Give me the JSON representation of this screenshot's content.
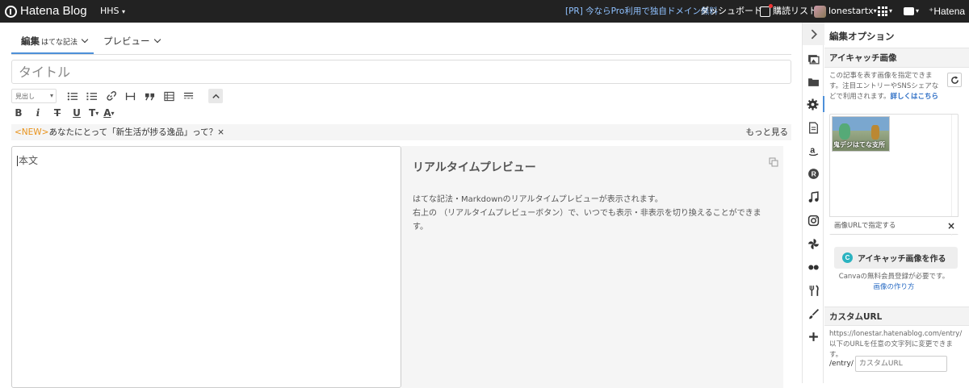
{
  "topbar": {
    "logo": "Hatena Blog",
    "blog": "HHS",
    "promo": "[PR] 今ならPro利用で独自ドメイン無料",
    "dashboard": "ダッシュボード",
    "reading_list": "購読リスト",
    "user": "lonestartx",
    "hatena": "Hatena"
  },
  "tabs": {
    "edit": "編集",
    "edit_mode": "はてな記法",
    "preview": "プレビュー"
  },
  "title": {
    "placeholder": "タイトル"
  },
  "toolbar": {
    "heading_select": "見出し"
  },
  "format": {
    "bold": "B",
    "italic": "i",
    "strike": "T",
    "underline": "U",
    "size": "T",
    "color": "A"
  },
  "notice": {
    "tag": "<NEW>",
    "text": "あなたにとって「新生活が捗る逸品」って？",
    "close": "×",
    "more": "もっと見る"
  },
  "editor": {
    "placeholder": "本文"
  },
  "preview": {
    "title": "リアルタイムプレビュー",
    "line1": "はてな記法・Markdownのリアルタイムプレビューが表示されます。",
    "line2": "右上の （リアルタイムプレビューボタン）で、いつでも表示・非表示を切り換えることができます。"
  },
  "panel": {
    "title": "編集オプション",
    "eyecatch": {
      "heading": "アイキャッチ画像",
      "desc": "この記事を表す画像を指定できます。注目エントリーやSNSシェアなどで利用されます。",
      "link": "詳しくはこちら",
      "thumb_caption": "鬼デジはてな支所",
      "url_label": "画像URLで指定する",
      "url_close": "×",
      "canva_button": "アイキャッチ画像を作る",
      "canva_icon": "C",
      "canva_note": "Canvaの無料会員登録が必要です。",
      "canva_link": "画像の作り方"
    },
    "custom_url": {
      "heading": "カスタムURL",
      "desc": "https://lonestar.hatenablog.com/entry/以下のURLを任意の文字列に変更できます。",
      "prefix": "/entry/",
      "placeholder": "カスタムURL"
    }
  },
  "colors": {
    "topbar": "#222222",
    "accent": "#4d90d9",
    "link": "#2a6cc4",
    "new_tag": "#e8921a",
    "canva": "#2bb3c0"
  }
}
